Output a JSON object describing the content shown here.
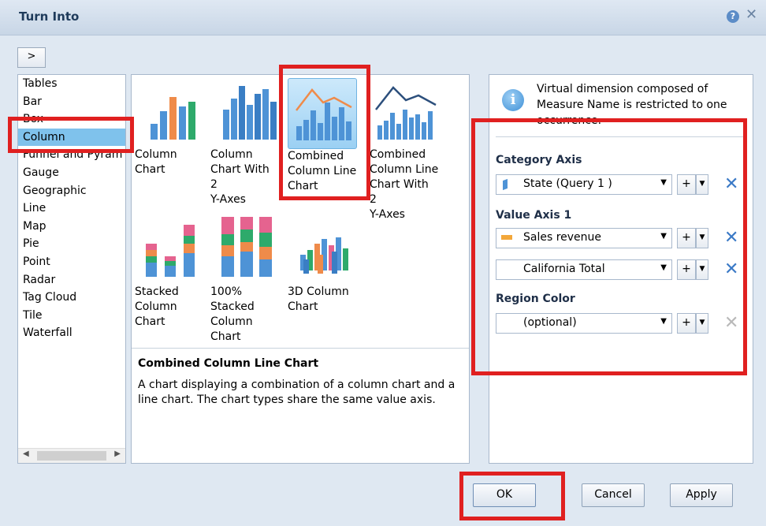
{
  "dialog": {
    "title": "Turn Into",
    "help_icon": "question-icon",
    "close_icon": "close-icon",
    "expand_label": ">"
  },
  "categories": [
    {
      "label": "Tables"
    },
    {
      "label": "Bar"
    },
    {
      "label": "Box"
    },
    {
      "label": "Column",
      "selected": true
    },
    {
      "label": "Funnel and Pyram"
    },
    {
      "label": "Gauge"
    },
    {
      "label": "Geographic"
    },
    {
      "label": "Line"
    },
    {
      "label": "Map"
    },
    {
      "label": "Pie"
    },
    {
      "label": "Point"
    },
    {
      "label": "Radar"
    },
    {
      "label": "Tag Cloud"
    },
    {
      "label": "Tile"
    },
    {
      "label": "Waterfall"
    }
  ],
  "charts": [
    {
      "label": "Column\nChart",
      "icon": "column-chart-icon"
    },
    {
      "label": "Column\nChart With 2\nY-Axes",
      "icon": "column-chart-two-axes-icon"
    },
    {
      "label": "Combined\nColumn Line\nChart",
      "icon": "combined-column-line-icon",
      "selected": true
    },
    {
      "label": "Combined\nColumn Line\nChart With 2\nY-Axes",
      "icon": "combined-column-line-two-axes-icon"
    },
    {
      "label": "Stacked\nColumn\nChart",
      "icon": "stacked-column-icon"
    },
    {
      "label": "100%\nStacked\nColumn\nChart",
      "icon": "percent-stacked-column-icon"
    },
    {
      "label": "3D Column\nChart",
      "icon": "3d-column-icon"
    }
  ],
  "description": {
    "title": "Combined Column Line Chart",
    "text": "A chart displaying a combination of a column chart and a line chart. The chart types share the same value axis."
  },
  "info": {
    "text": "Virtual dimension composed of Measure Name is restricted to one occurrence."
  },
  "axes": {
    "category_label": "Category Axis",
    "category_value": "State (Query 1 )",
    "value_axis_label": "Value Axis 1",
    "value_1": "Sales revenue",
    "value_2": "California Total",
    "region_label": "Region Color",
    "region_value": "(optional)",
    "plus": "+"
  },
  "buttons": {
    "ok": "OK",
    "cancel": "Cancel",
    "apply": "Apply"
  },
  "colors": {
    "accent": "#3a79c6",
    "highlight": "#e02020",
    "selection": "#7fc2ec",
    "bar_blue": "#4e93d6",
    "bar_orange": "#ef8b4a",
    "bar_green": "#2eaa6b",
    "bar_pink": "#e5638f"
  }
}
